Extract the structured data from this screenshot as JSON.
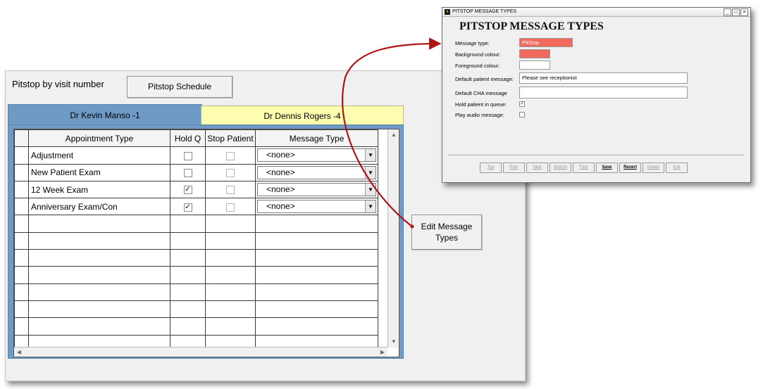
{
  "main": {
    "pitstop_label": "Pitstop by visit number",
    "schedule_button": "Pitstop Schedule",
    "edit_button_line1": "Edit Message",
    "edit_button_line2": "Types",
    "tabs": [
      {
        "label": "Dr Kevin Manso  -1",
        "active": true
      },
      {
        "label": "Dr Dennis Rogers  -4",
        "active": false
      }
    ],
    "grid": {
      "headers": [
        "Appointment Type",
        "Hold Q",
        "Stop Patient",
        "Message Type"
      ],
      "rows": [
        {
          "type": "Adjustment",
          "hold": false,
          "stop": false,
          "message": "<none>"
        },
        {
          "type": "New Patient Exam",
          "hold": false,
          "stop": false,
          "message": "<none>"
        },
        {
          "type": "12 Week Exam",
          "hold": true,
          "stop": false,
          "message": "<none>"
        },
        {
          "type": "Anniversary Exam/Con",
          "hold": true,
          "stop": false,
          "message": "<none>"
        }
      ]
    }
  },
  "dialog": {
    "window_title": "PITSTOP MESSAGE TYPES",
    "heading": "PITSTOP MESSAGE TYPES",
    "labels": {
      "message_type": "Message type:",
      "background": "Background colour:",
      "foreground": "Foreground colour:",
      "default_patient": "Default patient message:",
      "default_cha": "Default CHA message",
      "hold": "Hold patient in queue:",
      "audio": "Play audio message:"
    },
    "values": {
      "message_type": "PitStop",
      "default_patient": "Please see receptionist",
      "default_cha": "",
      "hold_checked": true,
      "audio_checked": false
    },
    "colors": {
      "message_type_bg": "#f26a5c",
      "background_colour": "#f26a5c",
      "foreground_colour": "#ffffff"
    },
    "buttons": [
      "Top",
      "Prev",
      "Next",
      "Bottom",
      "Find",
      "Save",
      "Revert",
      "Delete",
      "Exit"
    ],
    "enabled_buttons": [
      "Save",
      "Revert"
    ]
  },
  "annotation": {
    "arrow_color": "#b01515"
  }
}
